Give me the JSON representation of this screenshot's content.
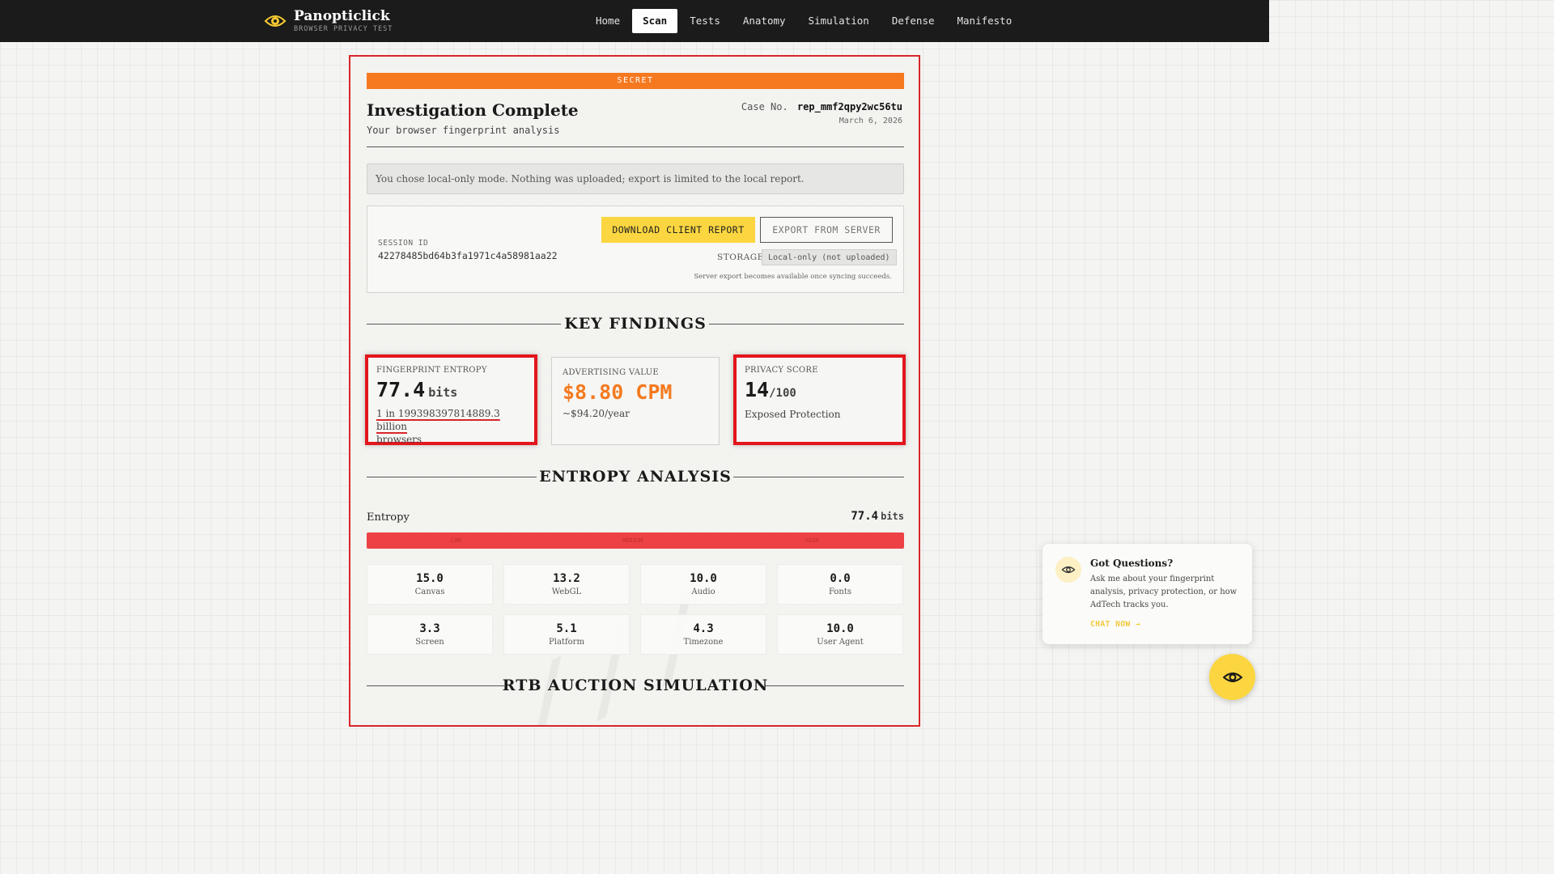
{
  "brand": {
    "name": "Panopticlick",
    "tagline": "BROWSER PRIVACY TEST"
  },
  "nav": {
    "items": [
      {
        "label": "Home",
        "active": false
      },
      {
        "label": "Scan",
        "active": true
      },
      {
        "label": "Tests",
        "active": false
      },
      {
        "label": "Anatomy",
        "active": false
      },
      {
        "label": "Simulation",
        "active": false
      },
      {
        "label": "Defense",
        "active": false
      },
      {
        "label": "Manifesto",
        "active": false
      }
    ]
  },
  "report": {
    "classification": "SECRET",
    "title": "Investigation Complete",
    "subtitle": "Your browser fingerprint analysis",
    "case_label": "Case No.",
    "case_no": "rep_mmf2qpy2wc56tu",
    "date": "March 6, 2026",
    "notice": "You chose local-only mode. Nothing was uploaded; export is limited to the local report.",
    "session": {
      "label": "SESSION ID",
      "id": "42278485bd64b3fa1971c4a58981aa22",
      "download_label": "DOWNLOAD CLIENT REPORT",
      "export_label": "EXPORT FROM SERVER",
      "storage_label": "STORAGE",
      "storage_value": "Local-only (not uploaded)",
      "server_note": "Server export becomes available once syncing succeeds."
    }
  },
  "key_findings": {
    "heading": "KEY FINDINGS",
    "entropy": {
      "label": "FINGERPRINT ENTROPY",
      "value": "77.4",
      "unit": "bits",
      "note_underlined": "1 in 199398397814889.3 billion",
      "note_rest": "browsers"
    },
    "ad_value": {
      "label": "ADVERTISING VALUE",
      "value": "$8.80 CPM",
      "note": "~$94.20/year"
    },
    "privacy": {
      "label": "PRIVACY SCORE",
      "value": "14",
      "max": "/100",
      "note": "Exposed Protection"
    }
  },
  "entropy_analysis": {
    "heading": "ENTROPY ANALYSIS",
    "label": "Entropy",
    "total": "77.4",
    "unit": "bits",
    "bar_labels": [
      "LOW",
      "MEDIUM",
      "HIGH"
    ],
    "metrics": [
      {
        "value": "15.0",
        "name": "Canvas"
      },
      {
        "value": "13.2",
        "name": "WebGL"
      },
      {
        "value": "10.0",
        "name": "Audio"
      },
      {
        "value": "0.0",
        "name": "Fonts"
      },
      {
        "value": "3.3",
        "name": "Screen"
      },
      {
        "value": "5.1",
        "name": "Platform"
      },
      {
        "value": "4.3",
        "name": "Timezone"
      },
      {
        "value": "10.0",
        "name": "User Agent"
      }
    ]
  },
  "rtb": {
    "heading": "RTB AUCTION SIMULATION"
  },
  "chat": {
    "title": "Got Questions?",
    "text": "Ask me about your fingerprint analysis, privacy protection, or how AdTech tracks you.",
    "cta": "CHAT NOW →"
  },
  "colors": {
    "accent_yellow": "#fbd640",
    "alert_red": "#e3161c",
    "classification_orange": "#f6781f",
    "entropy_red": "#ec4245"
  }
}
